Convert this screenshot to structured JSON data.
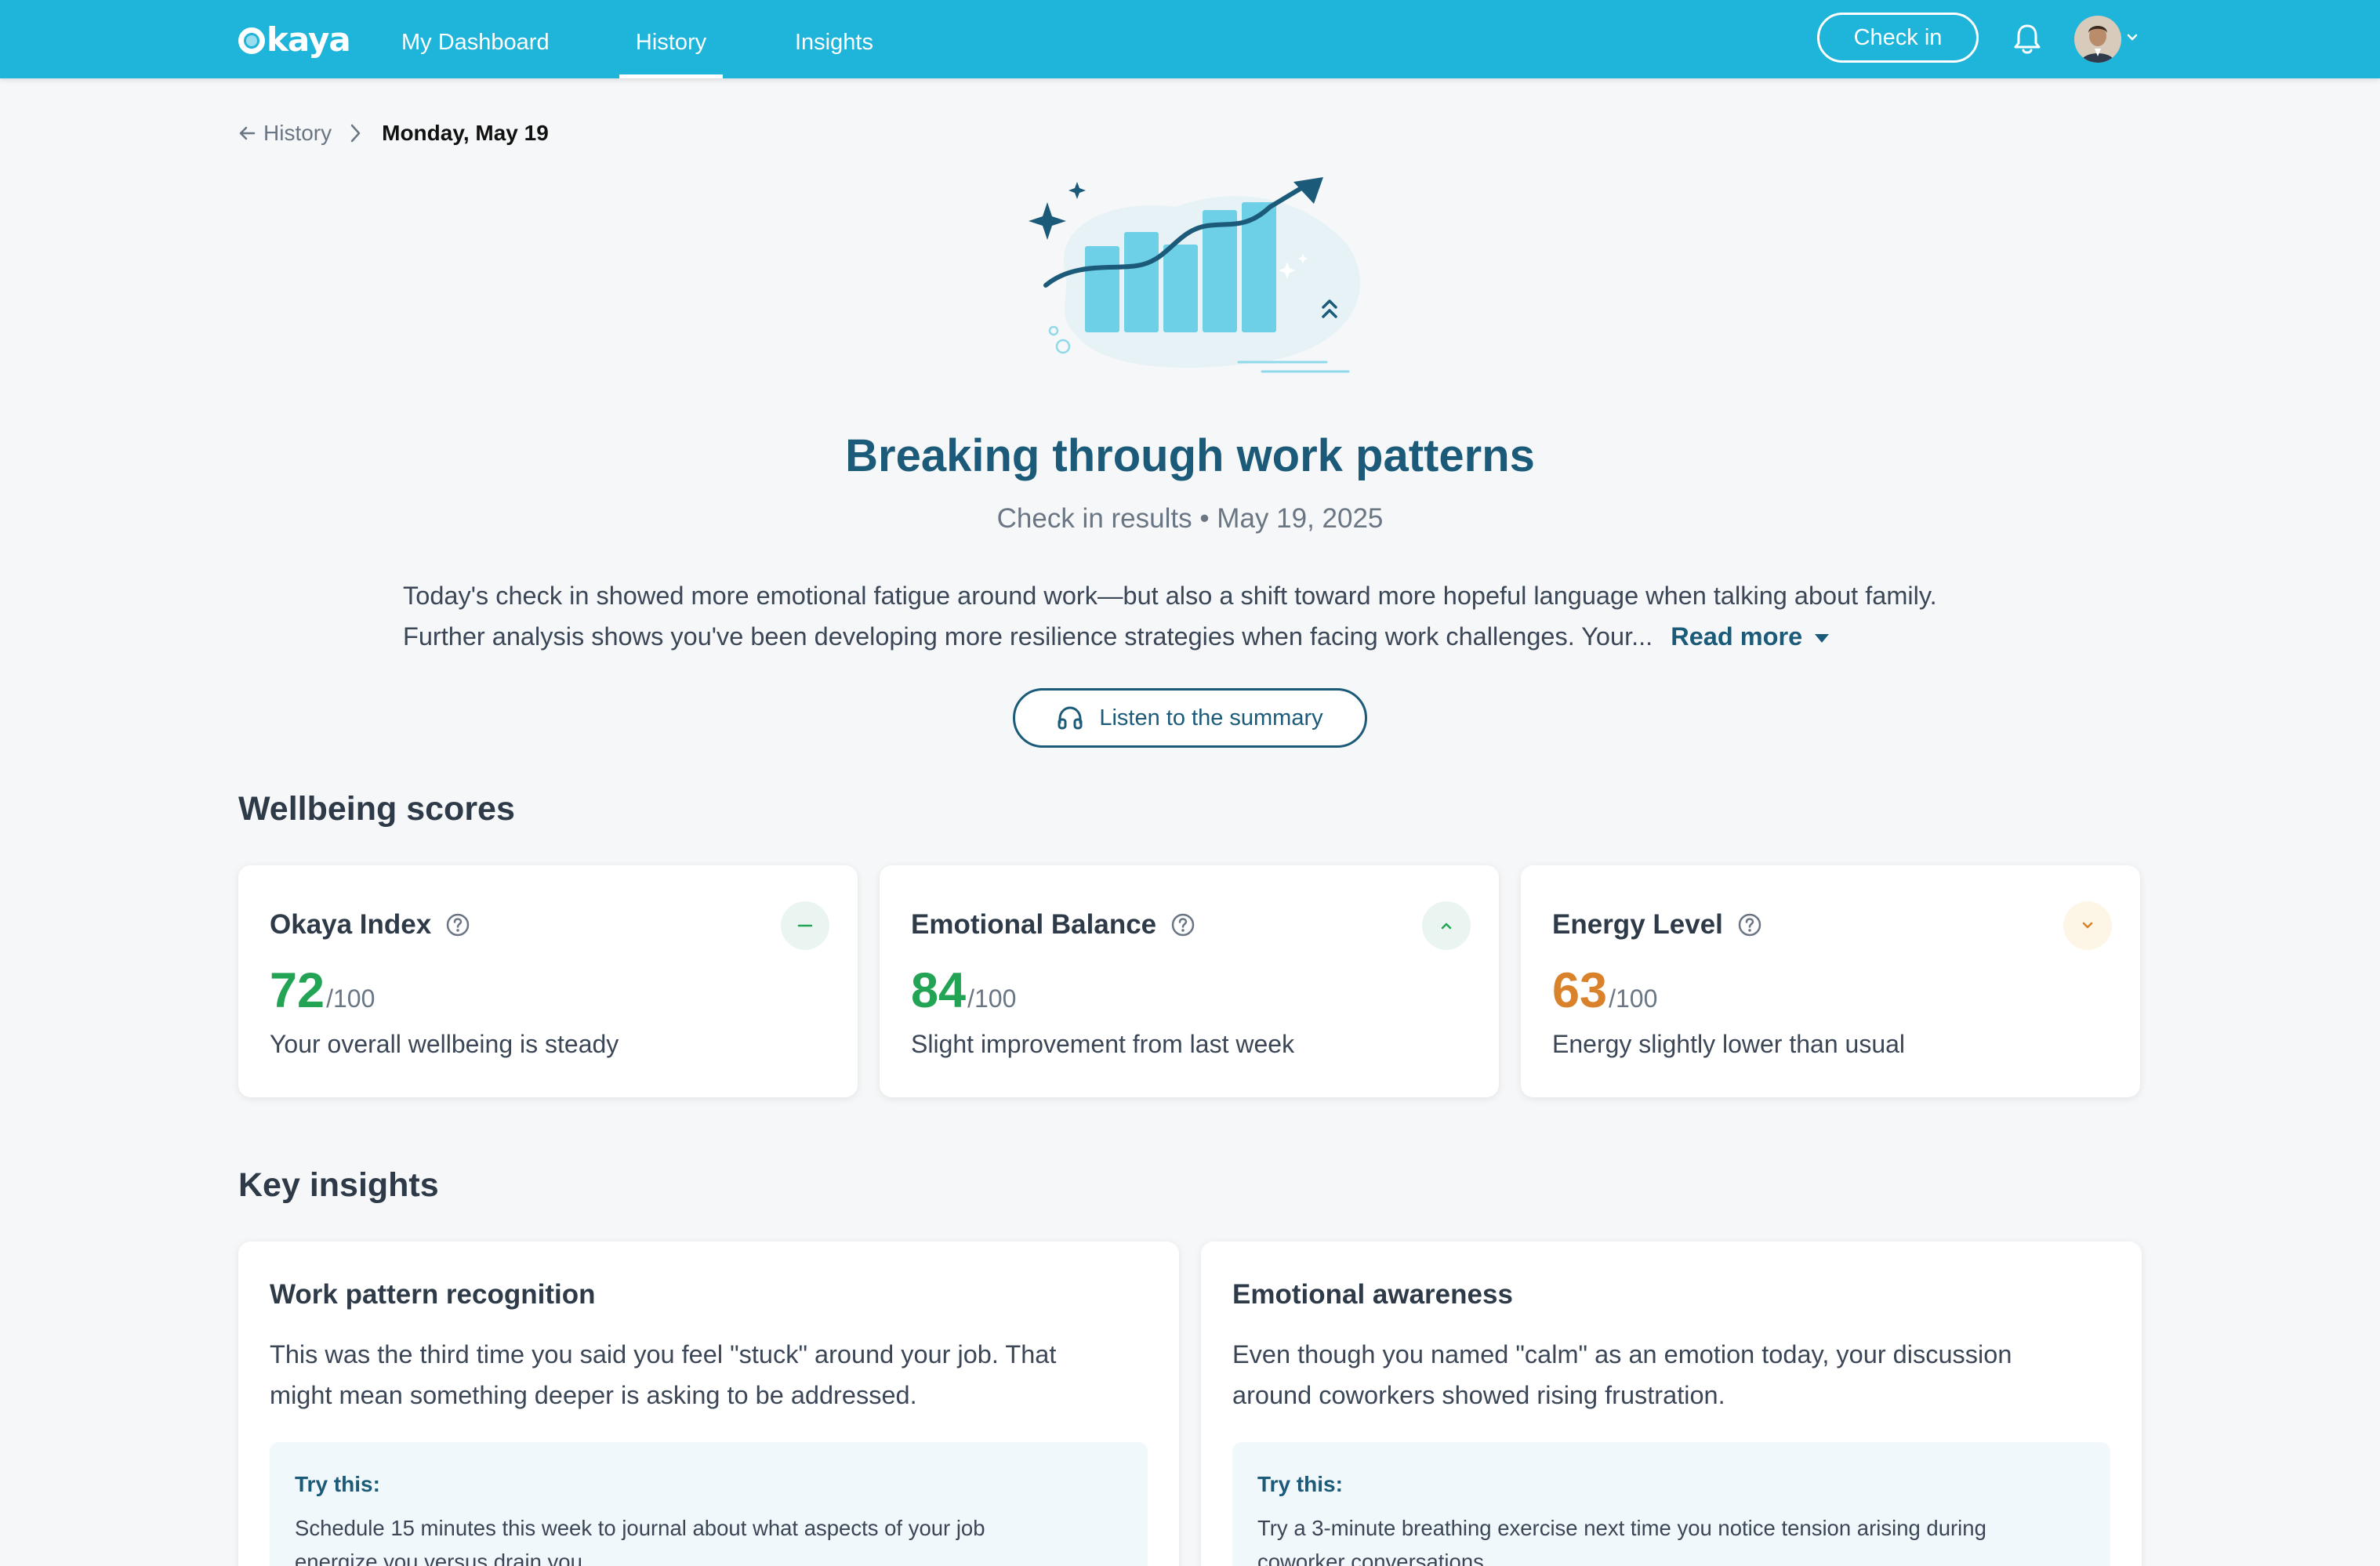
{
  "nav": {
    "logo": "kaya",
    "links": [
      "My Dashboard",
      "History",
      "Insights"
    ],
    "active": "History",
    "checkin_label": "Check in"
  },
  "breadcrumb": {
    "back_label": "History",
    "current": "Monday, May 19"
  },
  "hero": {
    "title": "Breaking through work patterns",
    "subtitle": "Check in results • May 19, 2025",
    "summary": "Today's check in showed more emotional fatigue around work—but also a shift toward more hopeful language when talking about family. Further analysis shows you've been developing more resilience strategies when facing work challenges. Your...",
    "read_more": "Read more",
    "listen_label": "Listen to the summary"
  },
  "wellbeing": {
    "heading": "Wellbeing scores",
    "cards": [
      {
        "title": "Okaya Index",
        "value": "72",
        "denom": "/100",
        "note": "Your overall wellbeing is steady",
        "trend": "steady",
        "color": "#23a455"
      },
      {
        "title": "Emotional Balance",
        "value": "84",
        "denom": "/100",
        "note": "Slight improvement from last week",
        "trend": "up",
        "color": "#23a455"
      },
      {
        "title": "Energy Level",
        "value": "63",
        "denom": "/100",
        "note": "Energy slightly lower than usual",
        "trend": "down",
        "color": "#d9822b"
      }
    ]
  },
  "insights": {
    "heading": "Key insights",
    "cards": [
      {
        "title": "Work pattern recognition",
        "body_line1": "This was the third time you said you feel \"stuck\" around your job. That",
        "body_line2": "might mean something deeper is asking to be addressed.",
        "try_label": "Try this:",
        "try_line1": "Schedule 15 minutes this week to journal about what aspects of your job",
        "try_line2": "energize you versus drain you."
      },
      {
        "title": "Emotional awareness",
        "body_line1": "Even though you named \"calm\" as an emotion today, your discussion",
        "body_line2": "around coworkers showed rising frustration.",
        "try_label": "Try this:",
        "try_line1": "Try a 3-minute breathing exercise next time you notice tension arising during",
        "try_line2": "coworker conversations."
      }
    ]
  },
  "colors": {
    "nav": "#1fb4d9",
    "primary": "#1b5a78",
    "good": "#23a455",
    "warn": "#d9822b"
  },
  "icons": [
    "bell-icon",
    "avatar",
    "chevron-down-icon",
    "arrow-left-icon",
    "chevron-right-icon",
    "headphones-icon",
    "help-icon",
    "minus-icon",
    "chevron-up-icon"
  ]
}
